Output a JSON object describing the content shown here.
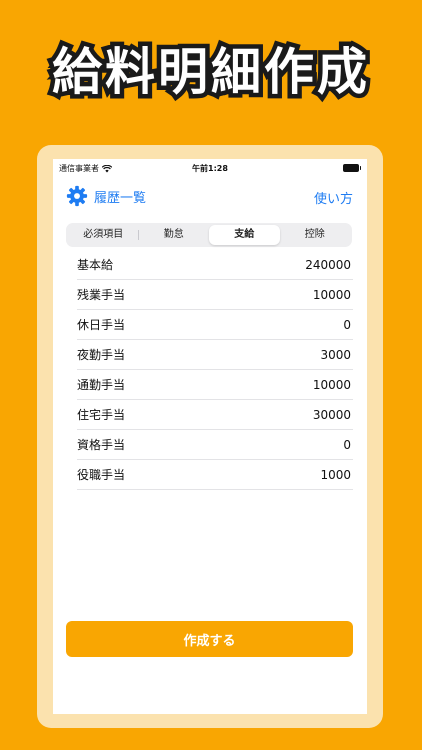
{
  "promo": {
    "title": "給料明細作成"
  },
  "status_bar": {
    "carrier": "通信事業者",
    "time": "午前1:28"
  },
  "nav": {
    "history_label": "履歴一覧",
    "help_label": "使い方"
  },
  "tabs": [
    {
      "label": "必須項目",
      "active": false
    },
    {
      "label": "勤怠",
      "active": false
    },
    {
      "label": "支給",
      "active": true
    },
    {
      "label": "控除",
      "active": false
    }
  ],
  "allowances": [
    {
      "label": "基本給",
      "value": "240000"
    },
    {
      "label": "残業手当",
      "value": "10000"
    },
    {
      "label": "休日手当",
      "value": "0"
    },
    {
      "label": "夜勤手当",
      "value": "3000"
    },
    {
      "label": "通勤手当",
      "value": "10000"
    },
    {
      "label": "住宅手当",
      "value": "30000"
    },
    {
      "label": "資格手当",
      "value": "0"
    },
    {
      "label": "役職手当",
      "value": "1000"
    }
  ],
  "create_button": {
    "label": "作成する"
  },
  "colors": {
    "brand_orange": "#F9A602",
    "link_blue": "#1E7CF2",
    "frame": "#FBE2AE"
  }
}
